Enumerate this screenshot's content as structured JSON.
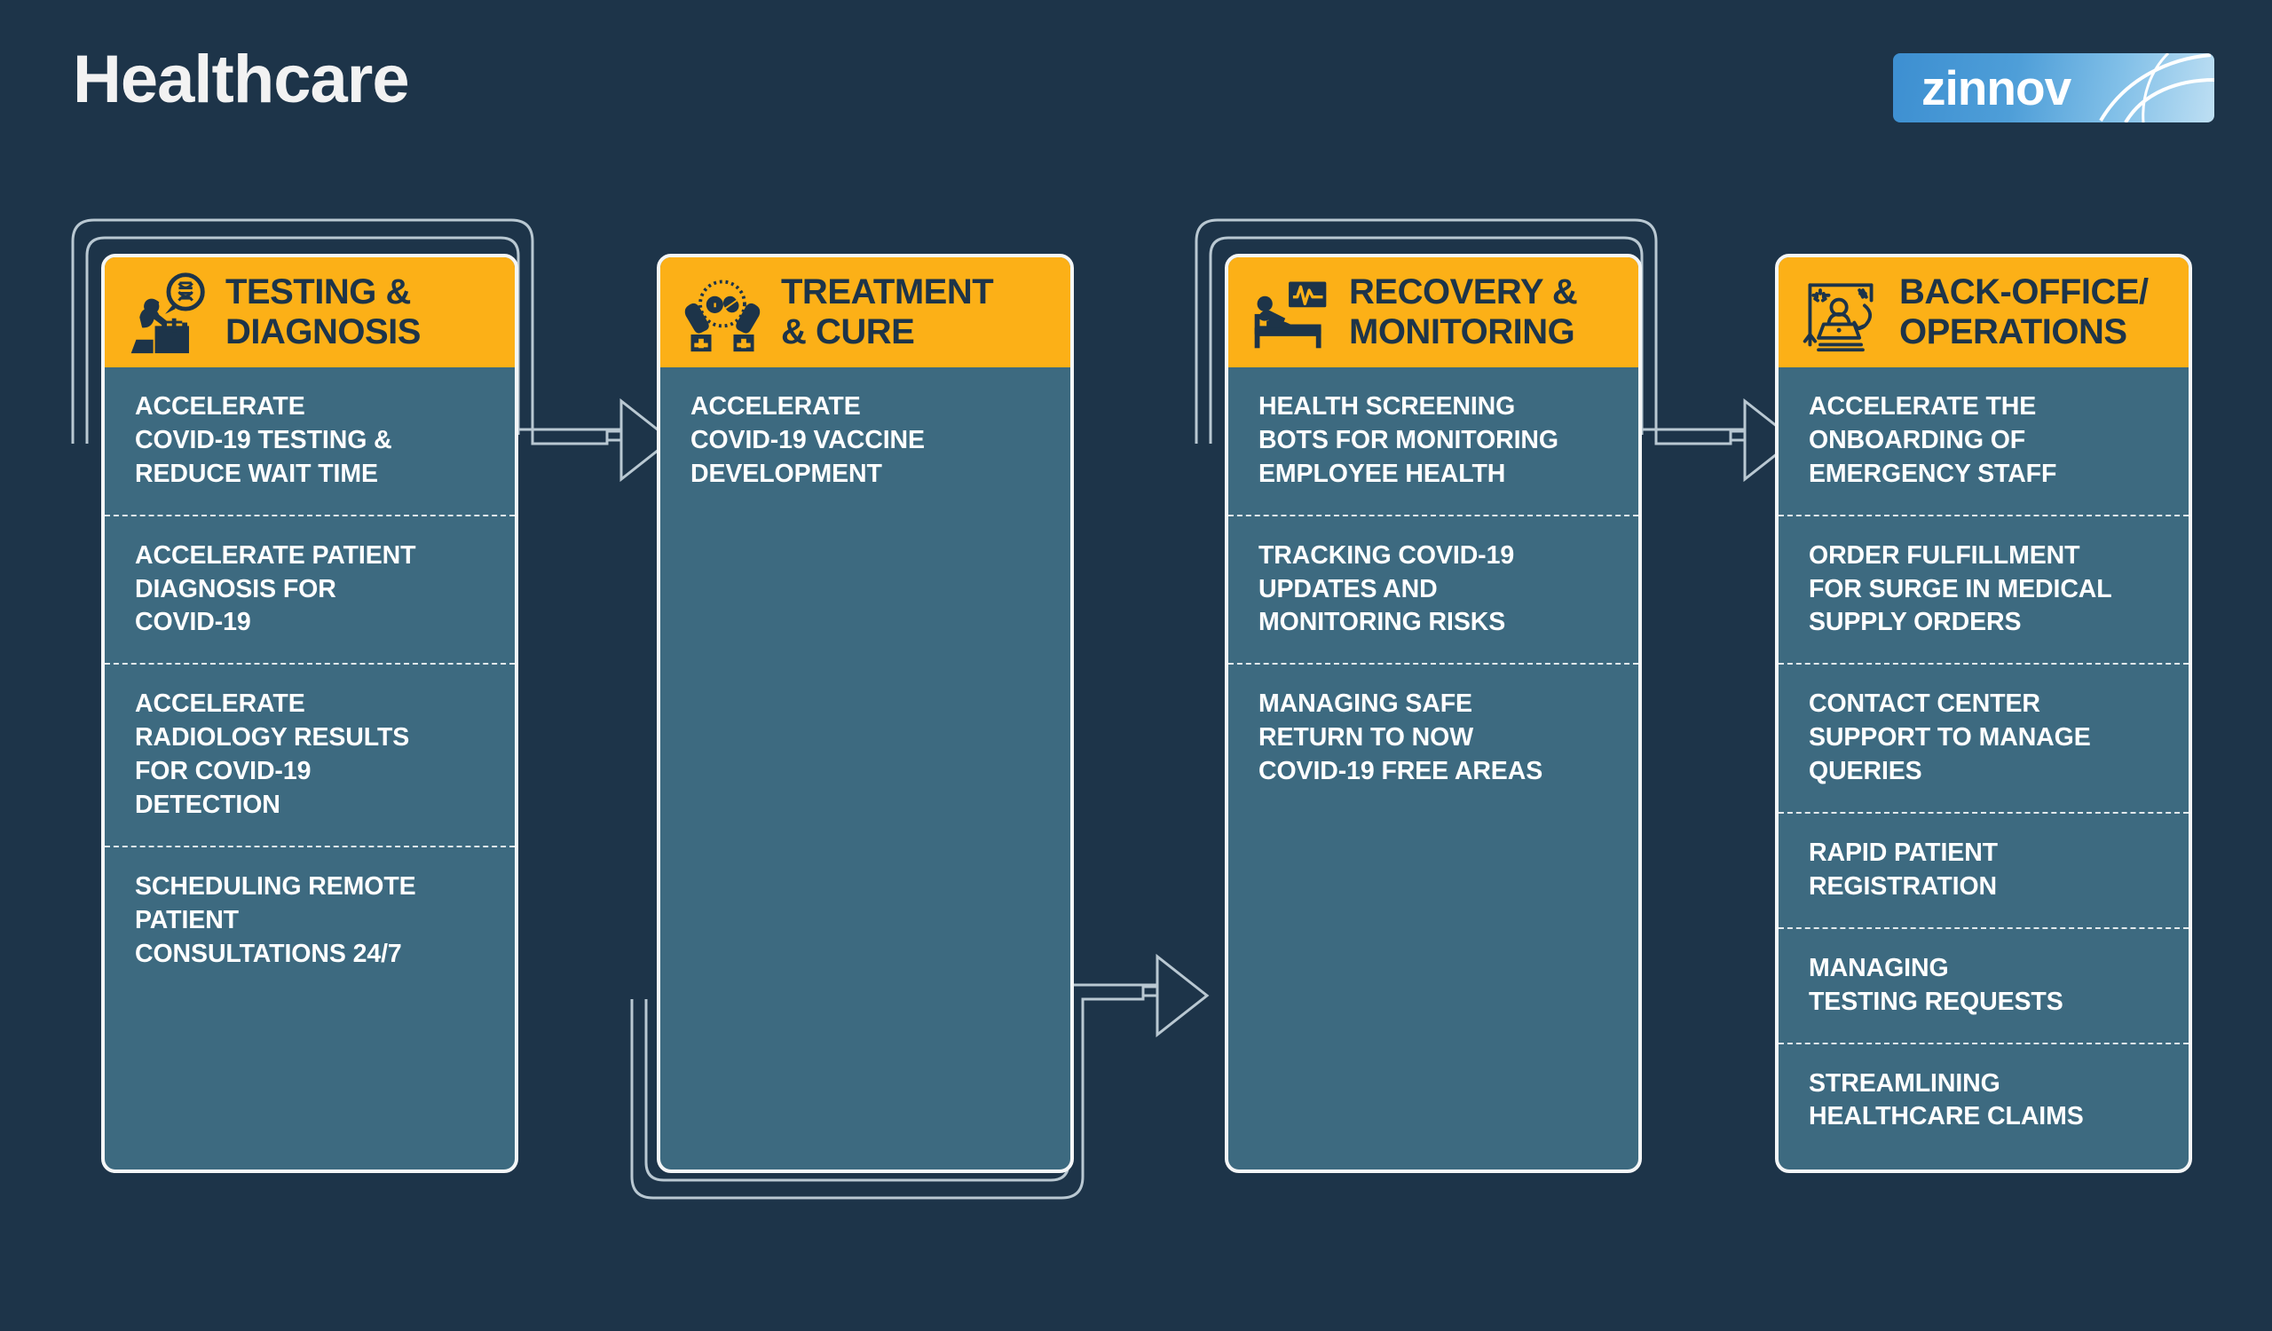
{
  "header": {
    "title": "Healthcare",
    "logo_text": "zinnov"
  },
  "colors": {
    "background": "#1d3449",
    "header_band": "#fcb017",
    "body_panel": "#3d6a80",
    "outline": "#f4f6f7",
    "title_text": "#f2f2f2",
    "header_text": "#1d3449",
    "item_text": "#ffffff"
  },
  "columns": [
    {
      "id": "testing-diagnosis",
      "icon": "lab-technician-microscope-dna-icon",
      "title": "TESTING &\nDIAGNOSIS",
      "items": [
        "ACCELERATE\nCOVID-19 TESTING &\nREDUCE WAIT TIME",
        "ACCELERATE PATIENT\nDIAGNOSIS FOR\nCOVID-19",
        "ACCELERATE\nRADIOLOGY RESULTS\nFOR COVID-19\nDETECTION",
        "SCHEDULING REMOTE\nPATIENT\nCONSULTATIONS 24/7"
      ]
    },
    {
      "id": "treatment-cure",
      "icon": "hands-holding-pills-icon",
      "title": "TREATMENT\n& CURE",
      "items": [
        "ACCELERATE\nCOVID-19 VACCINE\nDEVELOPMENT"
      ]
    },
    {
      "id": "recovery-monitoring",
      "icon": "patient-bed-ecg-monitor-icon",
      "title": "RECOVERY &\nMONITORING",
      "items": [
        "HEALTH SCREENING\nBOTS FOR MONITORING\nEMPLOYEE HEALTH",
        "TRACKING COVID-19\nUPDATES AND\nMONITORING RISKS",
        "MANAGING SAFE\nRETURN TO NOW\nCOVID-19 FREE AREAS"
      ]
    },
    {
      "id": "back-office-operations",
      "icon": "office-worker-laptop-desk-icon",
      "title": "BACK-OFFICE/\nOPERATIONS",
      "items": [
        "ACCELERATE THE\nONBOARDING OF\nEMERGENCY STAFF",
        "ORDER FULFILLMENT\nFOR SURGE IN MEDICAL\nSUPPLY ORDERS",
        "CONTACT CENTER\nSUPPORT TO MANAGE\nQUERIES",
        "RAPID PATIENT\nREGISTRATION",
        "MANAGING\nTESTING REQUESTS",
        "STREAMLINING\nHEALTHCARE CLAIMS"
      ]
    }
  ],
  "connectors": [
    {
      "id": "arrow-testing-to-treatment",
      "label": "flow-arrow"
    },
    {
      "id": "arrow-treatment-to-recovery",
      "label": "flow-arrow"
    },
    {
      "id": "arrow-recovery-to-backoffice",
      "label": "flow-arrow"
    }
  ]
}
